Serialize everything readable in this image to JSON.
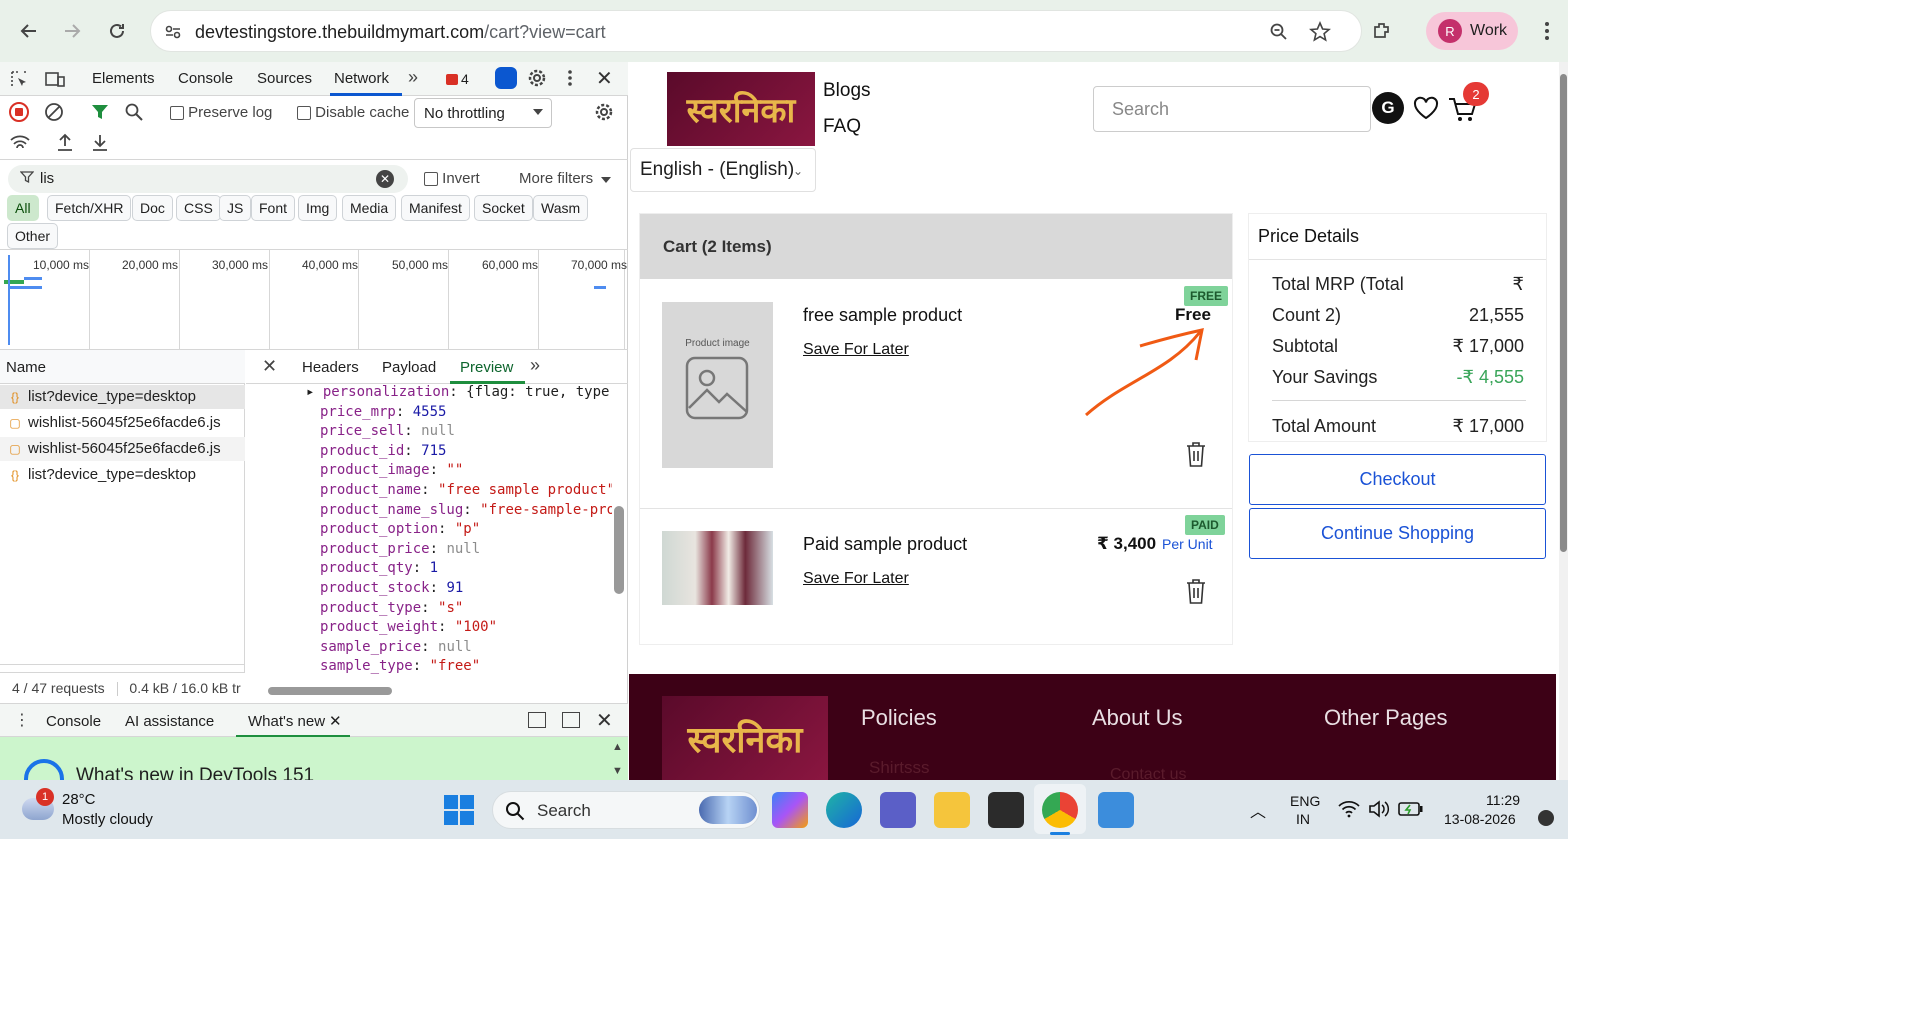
{
  "browser": {
    "url_host": "devtestingstore.thebuildmymart.com",
    "url_path": "/cart?view=cart",
    "profile_initial": "R",
    "profile_label": "Work"
  },
  "devtools": {
    "tabs": [
      "Elements",
      "Console",
      "Sources",
      "Network"
    ],
    "active_tab": "Network",
    "error_count": "4",
    "preserve_log": "Preserve log",
    "disable_cache": "Disable cache",
    "throttling": "No throttling",
    "filter_value": "lis",
    "invert": "Invert",
    "more_filters": "More filters",
    "type_filters": [
      "All",
      "Fetch/XHR",
      "Doc",
      "CSS",
      "JS",
      "Font",
      "Img",
      "Media",
      "Manifest",
      "Socket",
      "Wasm",
      "Other"
    ],
    "timeline_ticks": [
      "10,000 ms",
      "20,000 ms",
      "30,000 ms",
      "40,000 ms",
      "50,000 ms",
      "60,000 ms",
      "70,000 ms"
    ],
    "name_header": "Name",
    "requests": [
      "list?device_type=desktop",
      "wishlist-56045f25e6facde6.js",
      "wishlist-56045f25e6facde6.js",
      "list?device_type=desktop"
    ],
    "detail_tabs": [
      "Headers",
      "Payload",
      "Preview"
    ],
    "active_detail_tab": "Preview",
    "preview_lines": [
      {
        "key": "personalization",
        "val": "{flag: true, type:",
        "cls": "obj"
      },
      {
        "key": "price_mrp",
        "val": "4555",
        "cls": "num"
      },
      {
        "key": "price_sell",
        "val": "null",
        "cls": "nul"
      },
      {
        "key": "product_id",
        "val": "715",
        "cls": "num"
      },
      {
        "key": "product_image",
        "val": "\"\"",
        "cls": "str"
      },
      {
        "key": "product_name",
        "val": "\"free sample product\"",
        "cls": "str"
      },
      {
        "key": "product_name_slug",
        "val": "\"free-sample-proc",
        "cls": "str"
      },
      {
        "key": "product_option",
        "val": "\"p\"",
        "cls": "str"
      },
      {
        "key": "product_price",
        "val": "null",
        "cls": "nul"
      },
      {
        "key": "product_qty",
        "val": "1",
        "cls": "num"
      },
      {
        "key": "product_stock",
        "val": "91",
        "cls": "num"
      },
      {
        "key": "product_type",
        "val": "\"s\"",
        "cls": "str"
      },
      {
        "key": "product_weight",
        "val": "\"100\"",
        "cls": "str"
      },
      {
        "key": "sample_price",
        "val": "null",
        "cls": "nul"
      },
      {
        "key": "sample_type",
        "val": "\"free\"",
        "cls": "str"
      }
    ],
    "status_requests": "4 / 47 requests",
    "status_size": "0.4 kB / 16.0 kB tr",
    "drawer_tabs": [
      "Console",
      "AI assistance",
      "What's new"
    ],
    "whats_new_title": "What's new in DevTools 151"
  },
  "site": {
    "nav": [
      "Blogs",
      "FAQ"
    ],
    "search_placeholder": "Search",
    "avatar_initial": "G",
    "cart_count": "2",
    "language": "English - (English)",
    "cart_header": "Cart (2 Items)",
    "items": [
      {
        "name": "free sample product",
        "price": "Free",
        "unit": "",
        "badge": "FREE",
        "save_label": "Save For Later",
        "image_label": "Product image"
      },
      {
        "name": "Paid sample product",
        "price": "₹ 3,400",
        "unit": "Per Unit",
        "badge": "PAID",
        "save_label": "Save For Later",
        "image_label": ""
      }
    ],
    "price_details": {
      "title": "Price Details",
      "mrp_label_1": "Total MRP (Total",
      "mrp_label_2": "Count 2)",
      "mrp_currency": "₹",
      "mrp_value": "21,555",
      "subtotal_label": "Subtotal",
      "subtotal_value": "₹ 17,000",
      "savings_label": "Your Savings",
      "savings_value": "-₹ 4,555",
      "total_label": "Total Amount",
      "total_value": "₹ 17,000"
    },
    "checkout": "Checkout",
    "continue": "Continue Shopping",
    "footer": {
      "headings": [
        "Policies",
        "About Us",
        "Other Pages"
      ],
      "links": [
        "Shirtsss",
        "Contact us"
      ]
    }
  },
  "taskbar": {
    "weather_temp": "28°C",
    "weather_desc": "Mostly cloudy",
    "weather_badge": "1",
    "search": "Search",
    "lang_1": "ENG",
    "lang_2": "IN",
    "time": "11:29",
    "date": "13-08-2026"
  }
}
